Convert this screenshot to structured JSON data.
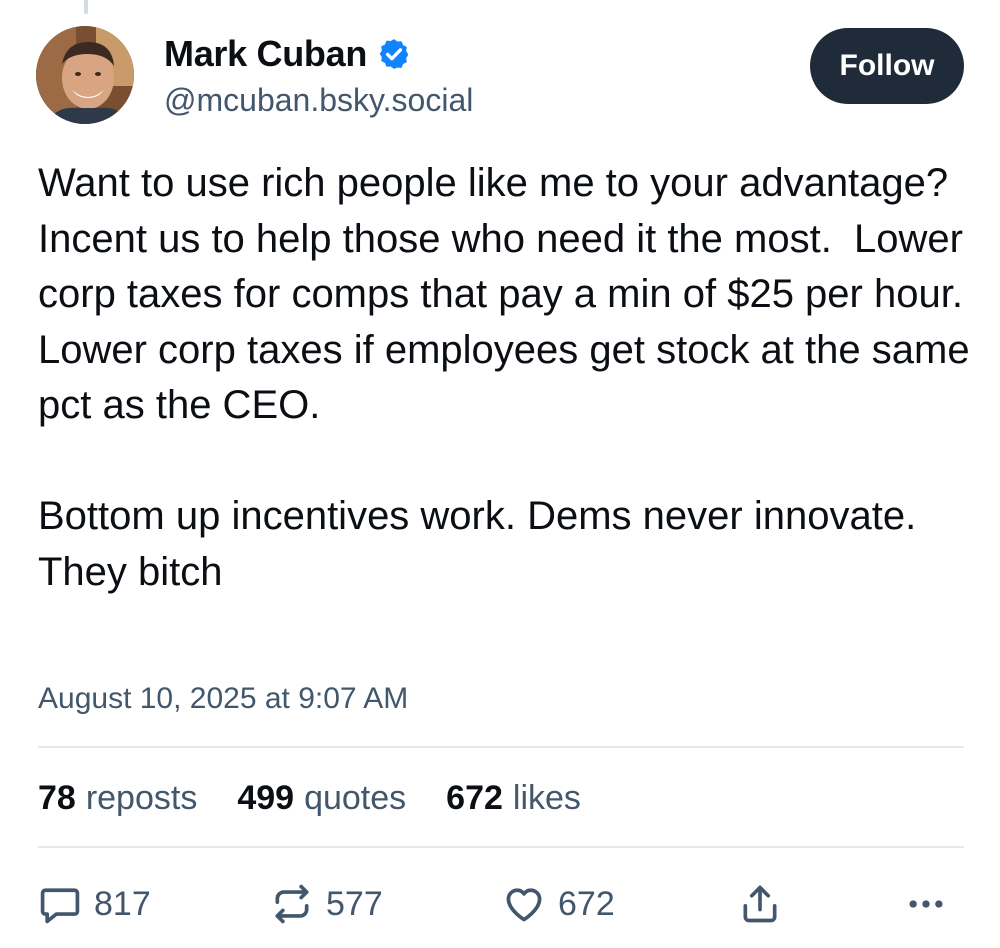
{
  "author": {
    "display_name": "Mark Cuban",
    "handle": "@mcuban.bsky.social",
    "verified": true
  },
  "follow_button": {
    "label": "Follow"
  },
  "post": {
    "text": "Want to use rich people like me to your advantage? Incent us to help those who need it the most.  Lower corp taxes for comps that pay a min of $25 per hour.  Lower corp taxes if employees get stock at the same pct as the CEO.\n\nBottom up incentives work. Dems never innovate. They bitch",
    "timestamp": "August 10, 2025 at 9:07 AM"
  },
  "stats": {
    "reposts": {
      "count": "78",
      "label": "reposts"
    },
    "quotes": {
      "count": "499",
      "label": "quotes"
    },
    "likes": {
      "count": "672",
      "label": "likes"
    }
  },
  "actions": {
    "reply": {
      "icon": "reply-bubble-icon",
      "count": "817"
    },
    "repost": {
      "icon": "repost-arrows-icon",
      "count": "577"
    },
    "like": {
      "icon": "heart-icon",
      "count": "672"
    },
    "share": {
      "icon": "share-upload-icon"
    },
    "more": {
      "icon": "ellipsis-icon"
    }
  },
  "colors": {
    "text_primary": "#0b0f14",
    "text_secondary": "#42576c",
    "follow_button_bg": "#1f2b38",
    "verified_blue": "#1083fe",
    "divider": "#e4e8ec"
  }
}
